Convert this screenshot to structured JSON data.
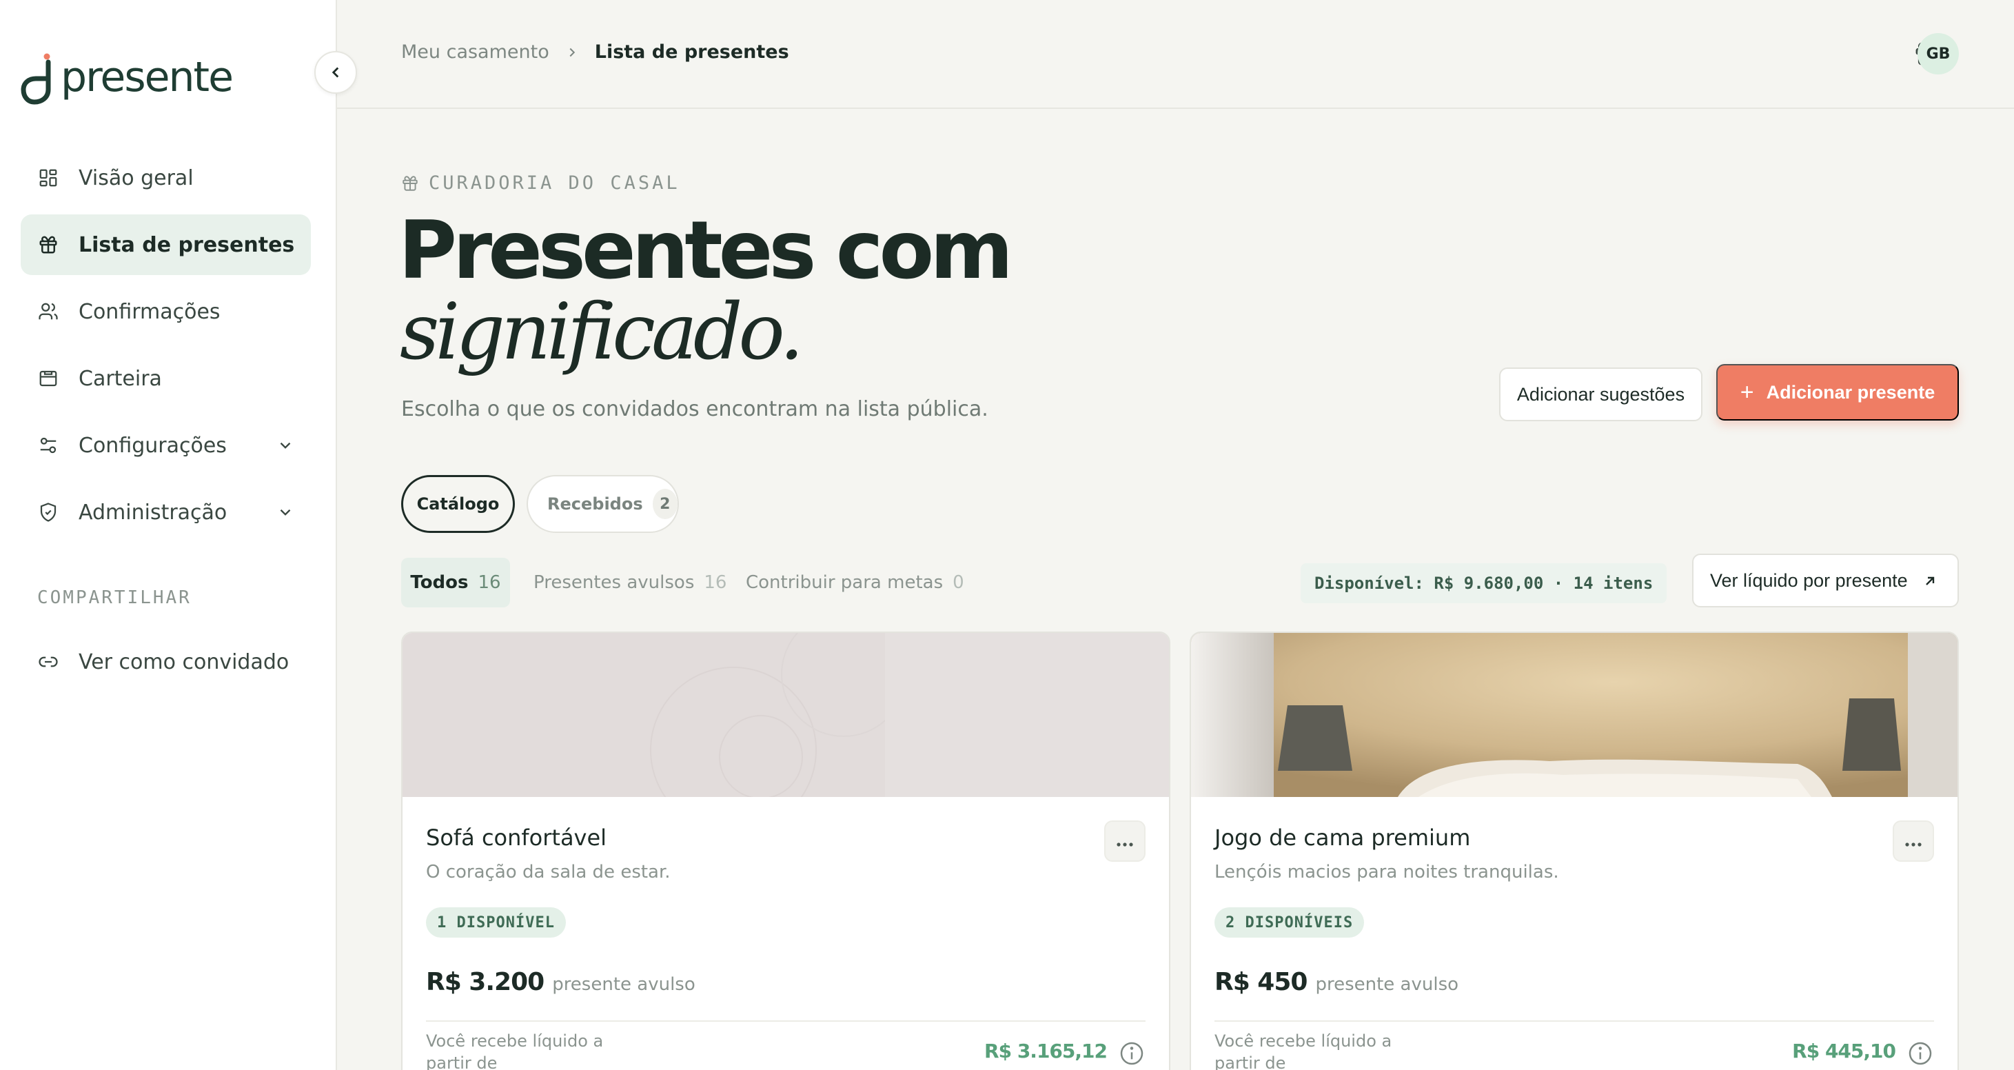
{
  "brand": {
    "name": "presente",
    "accent": "#ef7d64",
    "primary_dark": "#1d2b26",
    "mint": "#e8f1eb"
  },
  "sidebar": {
    "collapse_icon": "chevron-left-icon",
    "items": [
      {
        "label": "Visão geral",
        "icon": "grid-icon",
        "active": false
      },
      {
        "label": "Lista de presentes",
        "icon": "gift-icon",
        "active": true
      },
      {
        "label": "Confirmações",
        "icon": "users-icon",
        "active": false
      },
      {
        "label": "Carteira",
        "icon": "wallet-icon",
        "active": false
      },
      {
        "label": "Configurações",
        "icon": "sliders-icon",
        "active": false,
        "expandable": true
      },
      {
        "label": "Administração",
        "icon": "shield-icon",
        "active": false,
        "expandable": true
      }
    ],
    "share_section_label": "COMPARTILHAR",
    "share_item": {
      "label": "Ver como convidado",
      "icon": "link-icon"
    }
  },
  "topbar": {
    "breadcrumb": [
      "Meu casamento",
      "Lista de presentes"
    ],
    "avatar_initials": "GB",
    "notification_icon": "gift-icon"
  },
  "hero": {
    "eyebrow": "CURADORIA DO CASAL",
    "headline_line1": "Presentes com",
    "headline_line2": "significado.",
    "subtitle": "Escolha o que os convidados encontram na lista pública."
  },
  "actions": {
    "suggest_label": "Adicionar sugestões",
    "add_label": "Adicionar presente"
  },
  "segments": {
    "catalog_label": "Catálogo",
    "received_label": "Recebidos",
    "received_count": "2"
  },
  "filters": [
    {
      "label": "Todos",
      "count": "16",
      "active": true
    },
    {
      "label": "Presentes avulsos",
      "count": "16",
      "active": false
    },
    {
      "label": "Contribuir para metas",
      "count": "0",
      "active": false
    }
  ],
  "available_summary": "Disponível: R$ 9.680,00 · 14 itens",
  "net_button_label": "Ver líquido por presente",
  "cards": [
    {
      "title": "Sofá confortável",
      "description": "O coração da sala de estar.",
      "badge": "1 DISPONÍVEL",
      "price": "R$ 3.200",
      "price_type": "presente avulso",
      "net_label": "Você recebe líquido a partir de",
      "net_value": "R$ 3.165,12"
    },
    {
      "title": "Jogo de cama premium",
      "description": "Lençóis macios para noites tranquilas.",
      "badge": "2 DISPONÍVEIS",
      "price": "R$ 450",
      "price_type": "presente avulso",
      "net_label": "Você recebe líquido a partir de",
      "net_value": "R$ 445,10"
    }
  ]
}
